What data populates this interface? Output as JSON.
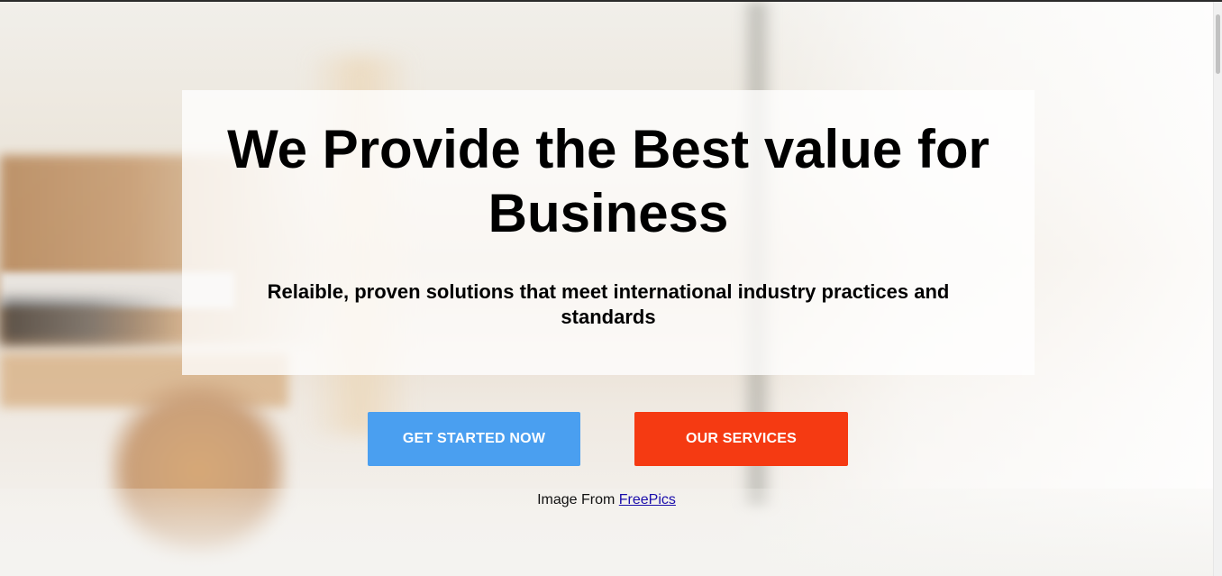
{
  "hero": {
    "title": "We Provide the Best value for Business",
    "subtitle": "Relaible, proven solutions that meet international industry practices and standards"
  },
  "actions": {
    "primary_label": "GET STARTED NOW",
    "secondary_label": "OUR SERVICES"
  },
  "credit": {
    "prefix": "Image From",
    "link_text": "FreePics"
  },
  "colors": {
    "primary_button": "#4a9ff0",
    "secondary_button": "#f53a12",
    "link": "#1a0dab"
  }
}
